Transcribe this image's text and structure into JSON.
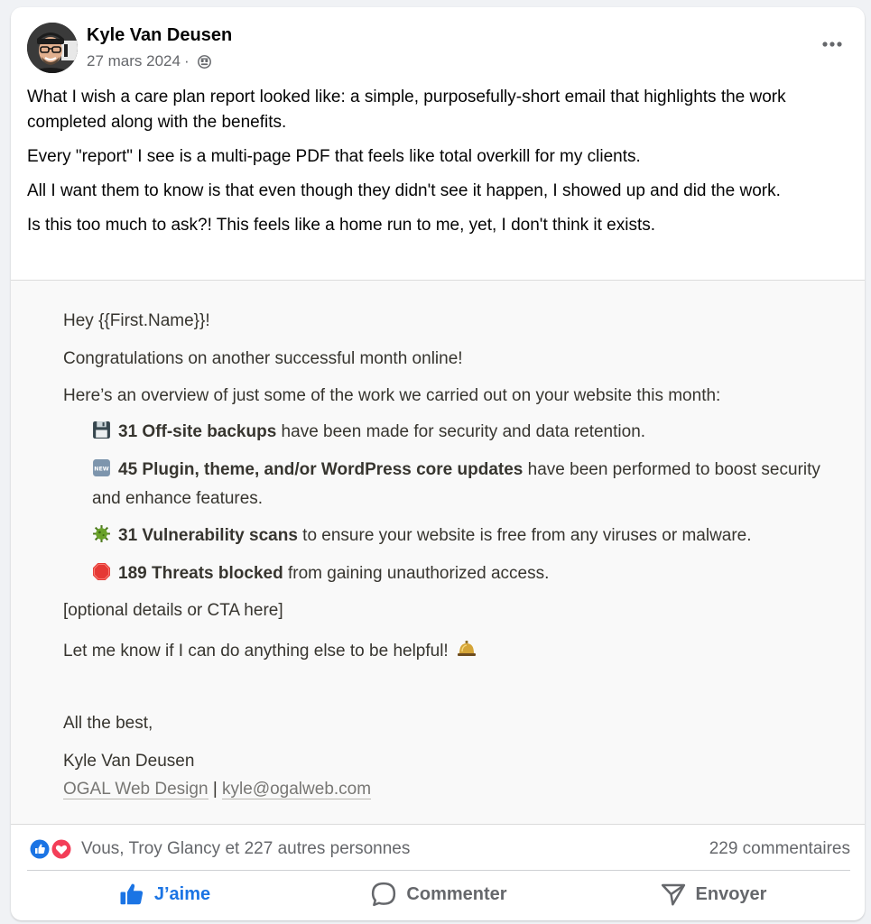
{
  "post": {
    "author": "Kyle Van Deusen",
    "date": "27 mars 2024",
    "separator": "·",
    "visibility_icon": "globe-icon",
    "paragraphs": [
      "What I wish a care plan report looked like: a simple, purposefully-short email that highlights the work completed along with the benefits.",
      "Every \"report\" I see is a multi-page PDF that feels like total overkill for my clients.",
      "All I want them to know is that even though they didn't see it happen, I showed up and did the work.",
      "Is this too much to ask?! This feels like a home run to me, yet, I don't think it exists."
    ]
  },
  "email": {
    "greeting": "Hey {{First.Name}}!",
    "congrats": "Congratulations on another successful month online!",
    "overview": "Here’s an overview of just some of the work we carried out on your website this month:",
    "bullets": [
      {
        "icon": "floppy-disk-icon",
        "bold": "31 Off-site backups",
        "rest": " have been made for security and data retention."
      },
      {
        "icon": "new-badge-icon",
        "bold": "45 Plugin, theme, and/or WordPress core updates",
        "rest": " have been performed to boost security and enhance features."
      },
      {
        "icon": "microbe-icon",
        "bold": "31 Vulnerability scans",
        "rest": " to ensure your website is free from any viruses or malware."
      },
      {
        "icon": "stop-sign-icon",
        "bold": "189 Threats blocked",
        "rest": " from gaining unauthorized access."
      }
    ],
    "optional": "[optional details or CTA here]",
    "helpful": "Let me know if I can do anything else to be helpful!",
    "closing": "All the best,",
    "signature_name": "Kyle Van Deusen",
    "company": "OGAL Web Design",
    "sig_separator": "|",
    "email_address": "kyle@ogalweb.com"
  },
  "stats": {
    "reactions": "Vous, Troy Glancy et 227 autres personnes",
    "comments": "229 commentaires",
    "colors": {
      "like": "#1b74e4",
      "love": "#f33e58"
    }
  },
  "actions": {
    "like": "J’aime",
    "comment": "Commenter",
    "share": "Envoyer"
  }
}
